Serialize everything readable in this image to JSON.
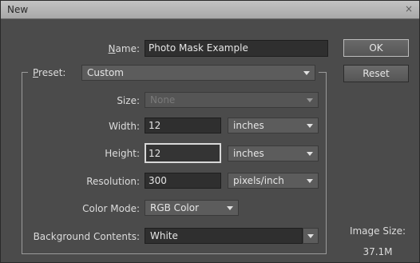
{
  "window": {
    "title": "New",
    "close_glyph": "×"
  },
  "name": {
    "label_access": "N",
    "label_rest": "ame:",
    "value": "Photo Mask Example"
  },
  "preset": {
    "label_access": "P",
    "label_rest": "reset:",
    "value": "Custom"
  },
  "size": {
    "label": "Size:",
    "value": "None"
  },
  "width": {
    "label": "Width:",
    "value": "12",
    "unit": "inches"
  },
  "height": {
    "label": "Height:",
    "value": "12",
    "unit": "inches"
  },
  "resolution": {
    "label": "Resolution:",
    "value": "300",
    "unit": "pixels/inch"
  },
  "color_mode": {
    "label": "Color Mode:",
    "value": "RGB Color"
  },
  "background": {
    "label": "Background Contents:",
    "value": "White"
  },
  "buttons": {
    "ok": "OK",
    "reset": "Reset"
  },
  "image_size": {
    "label": "Image Size:",
    "value": "37.1M"
  },
  "colors": {
    "dialog_bg": "#4b4b4b",
    "titlebar": "#b8b8b8",
    "field_bg": "#2f2f2f"
  }
}
